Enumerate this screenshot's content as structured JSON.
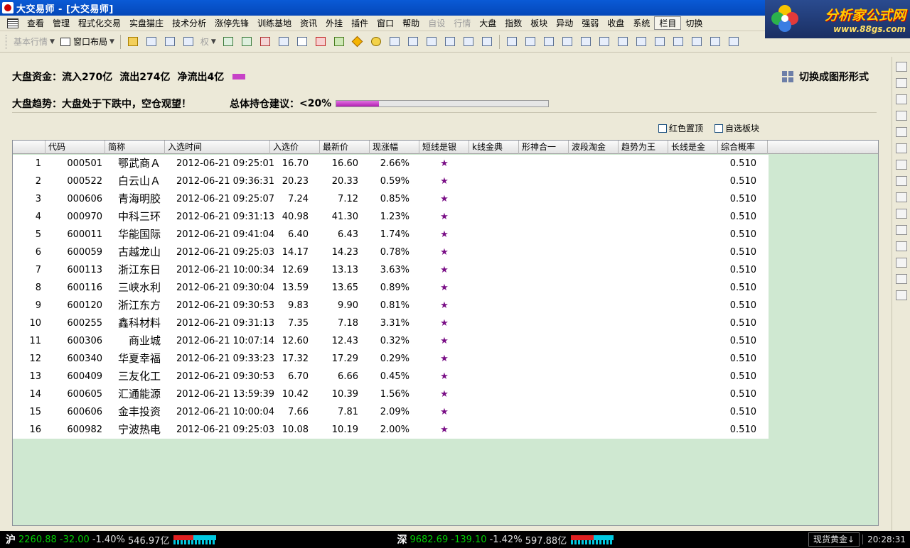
{
  "window": {
    "title": "大交易师 - [大交易师]"
  },
  "logo": {
    "line1": "分析家公式网",
    "line2": "www.88gs.com"
  },
  "menu": [
    {
      "label": "查看",
      "disabled": false
    },
    {
      "label": "管理",
      "disabled": false
    },
    {
      "label": "程式化交易",
      "disabled": false
    },
    {
      "label": "实盘猫庄",
      "disabled": false
    },
    {
      "label": "技术分析",
      "disabled": false
    },
    {
      "label": "涨停先锋",
      "disabled": false
    },
    {
      "label": "训练基地",
      "disabled": false
    },
    {
      "label": "资讯",
      "disabled": false
    },
    {
      "label": "外挂",
      "disabled": false
    },
    {
      "label": "插件",
      "disabled": false
    },
    {
      "label": "窗口",
      "disabled": false
    },
    {
      "label": "帮助",
      "disabled": false
    },
    {
      "label": "自设",
      "disabled": true
    },
    {
      "label": "行情",
      "disabled": true
    },
    {
      "label": "大盘",
      "disabled": false
    },
    {
      "label": "指数",
      "disabled": false
    },
    {
      "label": "板块",
      "disabled": false
    },
    {
      "label": "异动",
      "disabled": false
    },
    {
      "label": "强弱",
      "disabled": false
    },
    {
      "label": "收盘",
      "disabled": false
    },
    {
      "label": "系统",
      "disabled": false
    },
    {
      "label": "栏目",
      "disabled": false,
      "boxed": true
    },
    {
      "label": "切换",
      "disabled": false
    }
  ],
  "toolbar": {
    "basic_quote": "基本行情",
    "window_layout": "窗口布局",
    "rights_label": "权"
  },
  "summary": {
    "capital_label": "大盘资金：",
    "inflow": "流入270亿",
    "outflow": "流出274亿",
    "net": "净流出4亿",
    "trend_label": "大盘趋势：",
    "trend_text": "大盘处于下跌中，空仓观望！",
    "position_label": "总体持仓建议：",
    "position_value": "<20%",
    "position_fill": 0.2,
    "switch_label": "切换成图形形式"
  },
  "options": {
    "red_top": "红色置顶",
    "custom_sector": "自选板块"
  },
  "table": {
    "columns": [
      "",
      "代码",
      "简称",
      "入选时间",
      "入选价",
      "最新价",
      "现涨幅",
      "短线是银",
      "k线金典",
      "形神合一",
      "波段淘金",
      "趋势为王",
      "长线是金",
      "综合概率"
    ],
    "rows": [
      [
        "1",
        "000501",
        "鄂武商Ａ",
        "2012-06-21 09:25:01",
        "16.70",
        "16.60",
        "2.66%",
        "★",
        "0.510"
      ],
      [
        "2",
        "000522",
        "白云山Ａ",
        "2012-06-21 09:36:31",
        "20.23",
        "20.33",
        "0.59%",
        "★",
        "0.510"
      ],
      [
        "3",
        "000606",
        "青海明胶",
        "2012-06-21 09:25:07",
        "7.24",
        "7.12",
        "0.85%",
        "★",
        "0.510"
      ],
      [
        "4",
        "000970",
        "中科三环",
        "2012-06-21 09:31:13",
        "40.98",
        "41.30",
        "1.23%",
        "★",
        "0.510"
      ],
      [
        "5",
        "600011",
        "华能国际",
        "2012-06-21 09:41:04",
        "6.40",
        "6.43",
        "1.74%",
        "★",
        "0.510"
      ],
      [
        "6",
        "600059",
        "古越龙山",
        "2012-06-21 09:25:03",
        "14.17",
        "14.23",
        "0.78%",
        "★",
        "0.510"
      ],
      [
        "7",
        "600113",
        "浙江东日",
        "2012-06-21 10:00:34",
        "12.69",
        "13.13",
        "3.63%",
        "★",
        "0.510"
      ],
      [
        "8",
        "600116",
        "三峡水利",
        "2012-06-21 09:30:04",
        "13.59",
        "13.65",
        "0.89%",
        "★",
        "0.510"
      ],
      [
        "9",
        "600120",
        "浙江东方",
        "2012-06-21 09:30:53",
        "9.83",
        "9.90",
        "0.81%",
        "★",
        "0.510"
      ],
      [
        "10",
        "600255",
        "鑫科材料",
        "2012-06-21 09:31:13",
        "7.35",
        "7.18",
        "3.31%",
        "★",
        "0.510"
      ],
      [
        "11",
        "600306",
        "商业城",
        "2012-06-21 10:07:14",
        "12.60",
        "12.43",
        "0.32%",
        "★",
        "0.510"
      ],
      [
        "12",
        "600340",
        "华夏幸福",
        "2012-06-21 09:33:23",
        "17.32",
        "17.29",
        "0.29%",
        "★",
        "0.510"
      ],
      [
        "13",
        "600409",
        "三友化工",
        "2012-06-21 09:30:53",
        "6.70",
        "6.66",
        "0.45%",
        "★",
        "0.510"
      ],
      [
        "14",
        "600605",
        "汇通能源",
        "2012-06-21 13:59:39",
        "10.42",
        "10.39",
        "1.56%",
        "★",
        "0.510"
      ],
      [
        "15",
        "600606",
        "金丰投资",
        "2012-06-21 10:00:04",
        "7.66",
        "7.81",
        "2.09%",
        "★",
        "0.510"
      ],
      [
        "16",
        "600982",
        "宁波热电",
        "2012-06-21 09:25:03",
        "10.08",
        "10.19",
        "2.00%",
        "★",
        "0.510"
      ]
    ]
  },
  "status": {
    "sh_label": "沪",
    "sh_index": "2260.88",
    "sh_change": "-32.00",
    "sh_pct": "-1.40%",
    "sh_amount": "546.97亿",
    "sz_label": "深",
    "sz_index": "9682.69",
    "sz_change": "-139.10",
    "sz_pct": "-1.42%",
    "sz_amount": "597.88亿",
    "gold": "现货黄金↓",
    "time": "20:28:31"
  },
  "colors": {
    "title_bar": "#0447b8",
    "grid_background": "#cfe8d1",
    "star": "#7a0f86",
    "position_bar": "#b21eb2",
    "status_green": "#00d000"
  }
}
